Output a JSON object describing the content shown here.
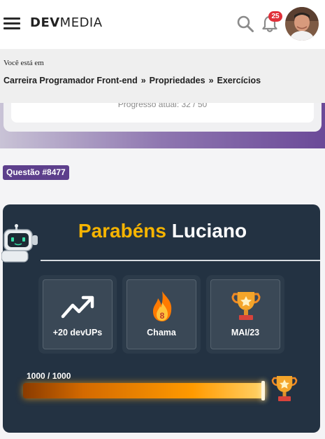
{
  "header": {
    "logo_bold": "DEV",
    "logo_light": "MEDIA",
    "notifications_count": "25"
  },
  "breadcrumb": {
    "prefix": "Você está em",
    "items": [
      "Carreira Programador Front-end",
      "Propriedades",
      "Exercícios"
    ],
    "separator": "»"
  },
  "progress": {
    "text": "Progresso atual: 32 / 50"
  },
  "question": {
    "tag": "Questão #8477"
  },
  "congrats": {
    "title_word": "Parabéns",
    "title_name": "Luciano",
    "stats": [
      {
        "label": "+20 devUPs",
        "icon": "trending-up-icon"
      },
      {
        "label": "Chama",
        "icon": "flame-icon",
        "value": "8"
      },
      {
        "label": "MAI/23",
        "icon": "trophy-icon"
      }
    ],
    "score_text": "1000 / 1000",
    "score_fraction": 1.0
  },
  "colors": {
    "accent_purple": "#5d3f8c",
    "card_bg": "#233242",
    "gold": "#f6b400",
    "badge_red": "#e0303a"
  }
}
